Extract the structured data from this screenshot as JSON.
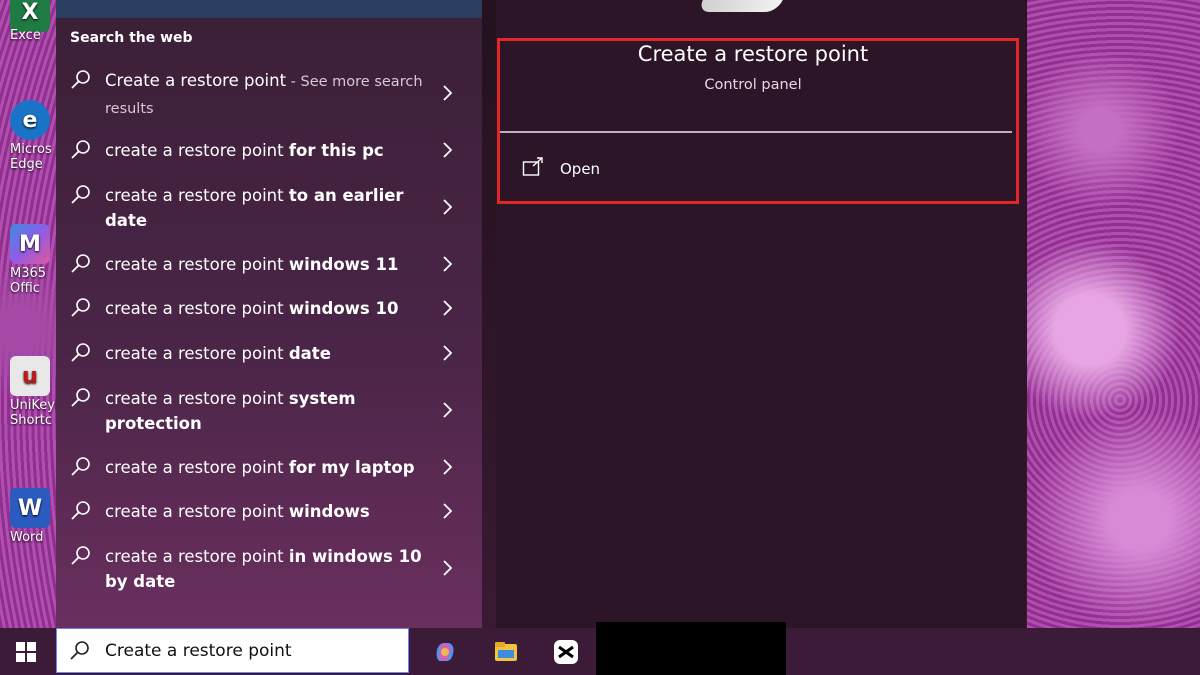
{
  "desktop": {
    "icons": [
      {
        "label": "Exce",
        "glyph": "X",
        "color": "#1f7a44"
      },
      {
        "label": "Micros Edge",
        "glyph": "e",
        "color": "#1a73c7"
      },
      {
        "label": "M365 Offic",
        "glyph": "M",
        "color": "#3b8de0"
      },
      {
        "label": "UniKeyl Shortc",
        "glyph": "u",
        "color": "#d8d8d8"
      },
      {
        "label": "Word",
        "glyph": "W",
        "color": "#2b5bbf"
      }
    ]
  },
  "search": {
    "section_title": "Search the web",
    "results": [
      {
        "prefix": "Create a restore point",
        "bold": "",
        "suffix": " - See more search results"
      },
      {
        "prefix": "create a restore point ",
        "bold": "for this pc",
        "suffix": ""
      },
      {
        "prefix": "create a restore point ",
        "bold": "to an earlier date",
        "suffix": ""
      },
      {
        "prefix": "create a restore point ",
        "bold": "windows 11",
        "suffix": ""
      },
      {
        "prefix": "create a restore point ",
        "bold": "windows 10",
        "suffix": ""
      },
      {
        "prefix": "create a restore point ",
        "bold": "date",
        "suffix": ""
      },
      {
        "prefix": "create a restore point ",
        "bold": "system protection",
        "suffix": ""
      },
      {
        "prefix": "create a restore point ",
        "bold": "for my laptop",
        "suffix": ""
      },
      {
        "prefix": "create a restore point ",
        "bold": "windows",
        "suffix": ""
      },
      {
        "prefix": "create a restore point ",
        "bold": "in windows 10 by date",
        "suffix": ""
      }
    ]
  },
  "detail": {
    "title": "Create a restore point",
    "subtitle": "Control panel",
    "action_label": "Open"
  },
  "taskbar": {
    "search_value": "Create a restore point",
    "accent": "#6a84ff"
  },
  "colors": {
    "highlight": "#e3262a"
  }
}
